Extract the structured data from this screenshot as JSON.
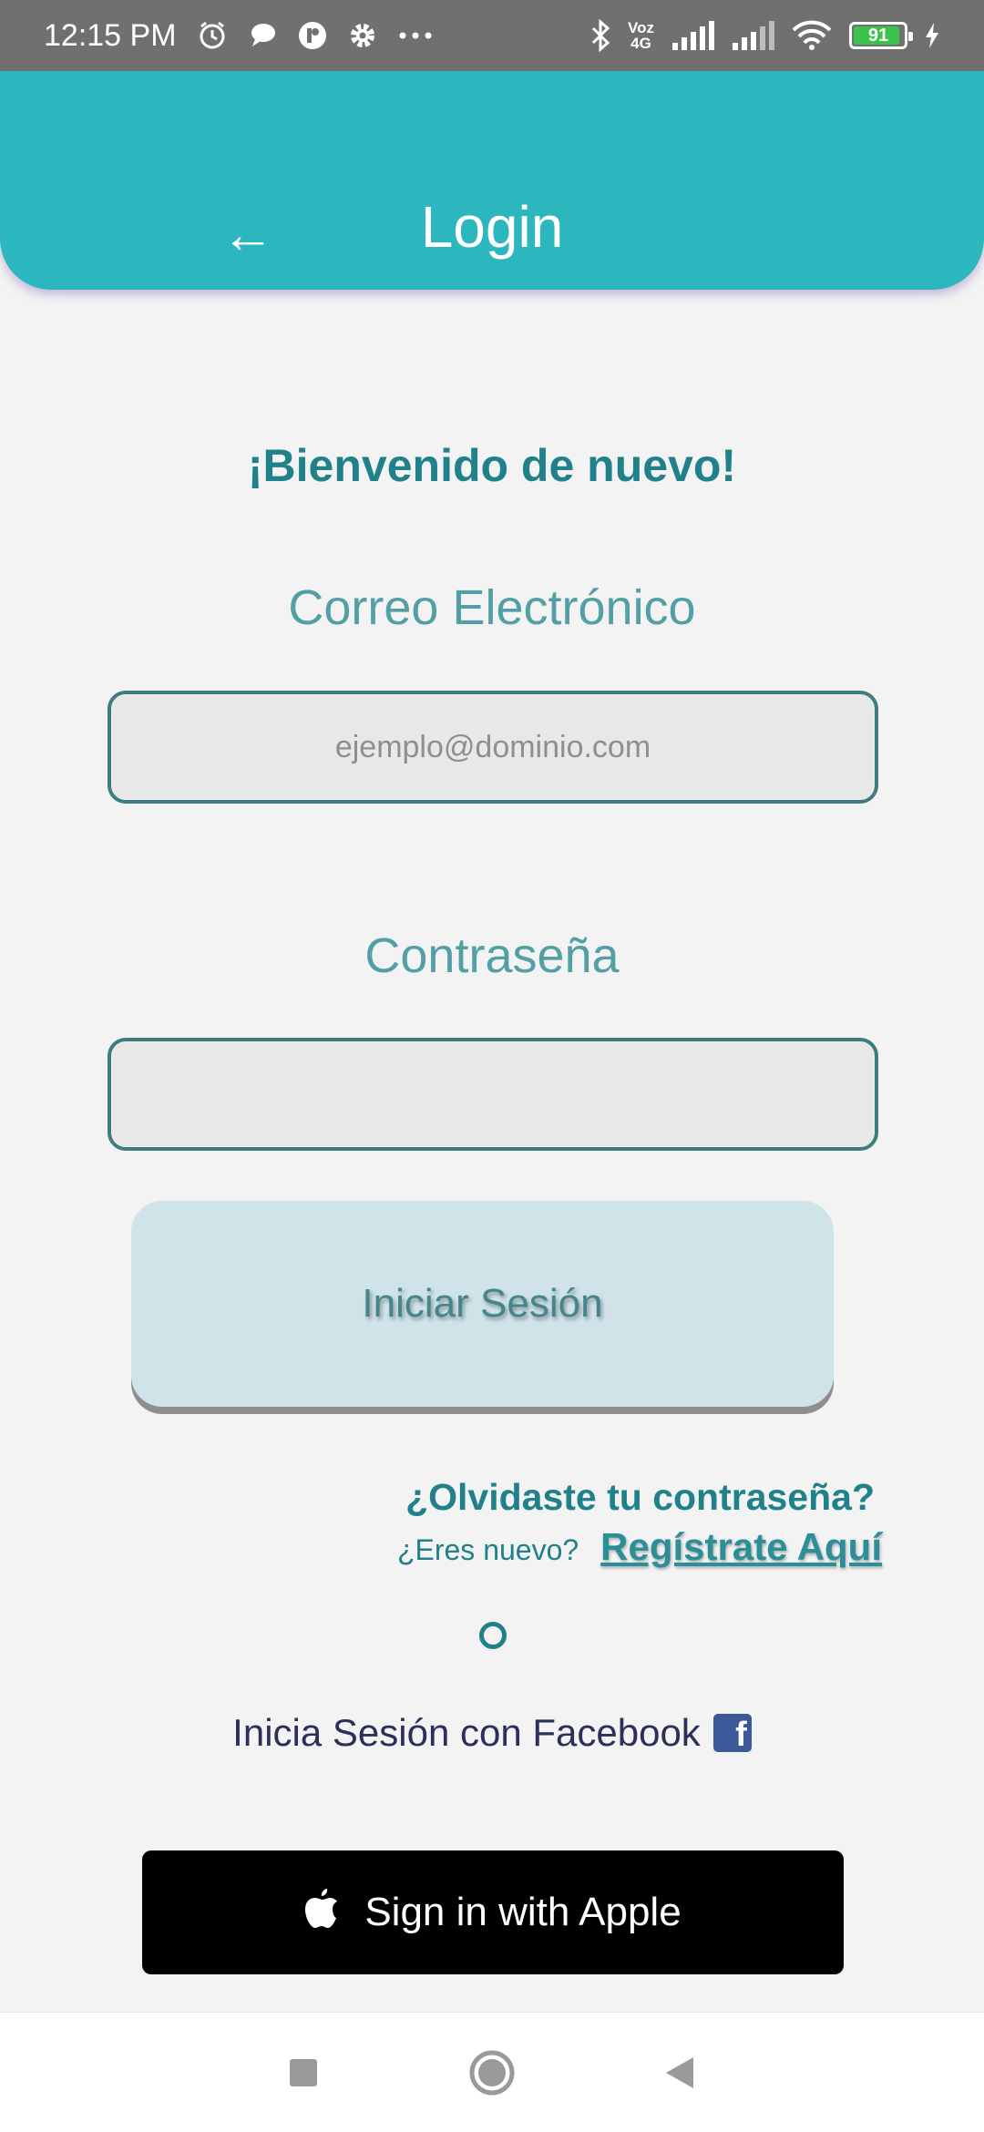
{
  "status_bar": {
    "time": "12:15 PM",
    "network_top": "Voz",
    "network_bottom": "4G",
    "battery_level": "91"
  },
  "header": {
    "back_icon": "arrow-left-icon",
    "title": "Login"
  },
  "main": {
    "welcome": "¡Bienvenido de nuevo!",
    "email_label": "Correo Electrónico",
    "email_placeholder": "ejemplo@dominio.com",
    "email_value": "",
    "password_label": "Contraseña",
    "password_value": "",
    "login_button": "Iniciar Sesión",
    "forgot_password": "¿Olvidaste tu contraseña?",
    "new_user_text": "¿Eres nuevo?",
    "register_link": "Regístrate Aquí",
    "facebook_text": "Inicia Sesión con Facebook",
    "facebook_icon_glyph": "f",
    "apple_button": "Sign in with Apple"
  },
  "colors": {
    "header": "#2cb6bd",
    "accent_text": "#20818a",
    "label_text": "#529fa6",
    "login_button_bg": "#cfe3e9",
    "facebook_blue": "#3b5998"
  },
  "nav_bar": {
    "icons": [
      "recent-apps-icon",
      "home-icon",
      "back-icon"
    ]
  }
}
